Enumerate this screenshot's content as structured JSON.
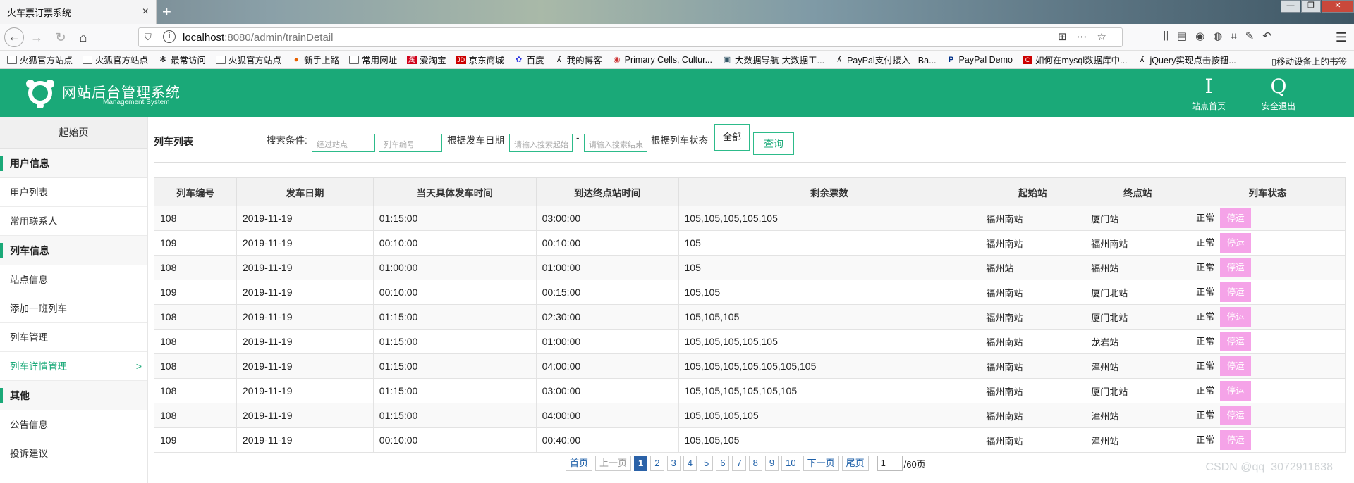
{
  "browser": {
    "tab_title": "火车票订票系统",
    "tab_close": "×",
    "new_tab": "+",
    "url_host": "localhost",
    "url_rest": ":8080/admin/trainDetail",
    "nav_back": "←",
    "nav_forward": "→",
    "nav_reload": "↻",
    "nav_home": "⌂",
    "window_controls": [
      "—",
      "❐",
      "✕"
    ]
  },
  "bookmarks": [
    {
      "label": "火狐官方站点",
      "icon": "folder-icon"
    },
    {
      "label": "火狐官方站点",
      "icon": "folder-icon"
    },
    {
      "label": "最常访问",
      "icon": "gear-icon"
    },
    {
      "label": "火狐官方站点",
      "icon": "folder-icon"
    },
    {
      "label": "新手上路",
      "icon": "firefox-icon"
    },
    {
      "label": "常用网址",
      "icon": "folder-icon"
    },
    {
      "label": "爱淘宝",
      "icon": "taobao-icon"
    },
    {
      "label": "京东商城",
      "icon": "jd-icon"
    },
    {
      "label": "百度",
      "icon": "baidu-icon"
    },
    {
      "label": "我的博客",
      "icon": "blog-icon"
    },
    {
      "label": "Primary Cells, Cultur...",
      "icon": "cell-icon"
    },
    {
      "label": "大数据导航-大数据工...",
      "icon": "bigdata-icon"
    },
    {
      "label": "PayPal支付接入 - Ba...",
      "icon": "blog-icon"
    },
    {
      "label": "PayPal Demo",
      "icon": "paypal-icon"
    },
    {
      "label": "如何在mysql数据库中...",
      "icon": "csdn-icon"
    },
    {
      "label": "jQuery实现点击按钮...",
      "icon": "blog-icon"
    }
  ],
  "bookmarks_mobile": "移动设备上的书签",
  "header": {
    "title": "网站后台管理系统",
    "subtitle": "Management System",
    "home_glyph": "I",
    "home_label": "站点首页",
    "logout_glyph": "Q",
    "logout_label": "安全退出"
  },
  "sidebar": {
    "start": "起始页",
    "groups": [
      {
        "title": "用户信息",
        "items": [
          "用户列表",
          "常用联系人"
        ]
      },
      {
        "title": "列车信息",
        "items": [
          "站点信息",
          "添加一班列车",
          "列车管理",
          "列车详情管理"
        ]
      },
      {
        "title": "其他",
        "items": [
          "公告信息",
          "投诉建议"
        ]
      }
    ],
    "active_arrow": ">"
  },
  "filters": {
    "list_title": "列车列表",
    "search_label": "搜索条件:",
    "station_placeholder": "经过站点",
    "train_placeholder": "列车编号",
    "date_label": "根据发车日期",
    "date_start_placeholder": "请输入搜索起始",
    "date_dash": "-",
    "date_end_placeholder": "请输入搜索结束",
    "status_label": "根据列车状态",
    "status_value": "全部",
    "query_button": "查询"
  },
  "table": {
    "headers": [
      "列车编号",
      "发车日期",
      "当天具体发车时间",
      "到达终点站时间",
      "剩余票数",
      "起始站",
      "终点站",
      "列车状态"
    ],
    "rows": [
      [
        "108",
        "2019-11-19",
        "01:15:00",
        "03:00:00",
        "105,105,105,105,105",
        "福州南站",
        "厦门站",
        "正常",
        "停运"
      ],
      [
        "109",
        "2019-11-19",
        "00:10:00",
        "00:10:00",
        "105",
        "福州南站",
        "福州南站",
        "正常",
        "停运"
      ],
      [
        "108",
        "2019-11-19",
        "01:00:00",
        "01:00:00",
        "105",
        "福州站",
        "福州站",
        "正常",
        "停运"
      ],
      [
        "109",
        "2019-11-19",
        "00:10:00",
        "00:15:00",
        "105,105",
        "福州南站",
        "厦门北站",
        "正常",
        "停运"
      ],
      [
        "108",
        "2019-11-19",
        "01:15:00",
        "02:30:00",
        "105,105,105",
        "福州南站",
        "厦门北站",
        "正常",
        "停运"
      ],
      [
        "108",
        "2019-11-19",
        "01:15:00",
        "01:00:00",
        "105,105,105,105,105",
        "福州南站",
        "龙岩站",
        "正常",
        "停运"
      ],
      [
        "108",
        "2019-11-19",
        "01:15:00",
        "04:00:00",
        "105,105,105,105,105,105,105",
        "福州南站",
        "漳州站",
        "正常",
        "停运"
      ],
      [
        "108",
        "2019-11-19",
        "01:15:00",
        "03:00:00",
        "105,105,105,105,105,105",
        "福州南站",
        "厦门北站",
        "正常",
        "停运"
      ],
      [
        "108",
        "2019-11-19",
        "01:15:00",
        "04:00:00",
        "105,105,105,105",
        "福州南站",
        "漳州站",
        "正常",
        "停运"
      ],
      [
        "109",
        "2019-11-19",
        "00:10:00",
        "00:40:00",
        "105,105,105",
        "福州南站",
        "漳州站",
        "正常",
        "停运"
      ]
    ]
  },
  "pager": {
    "first": "首页",
    "prev": "上一页",
    "pages": [
      "1",
      "2",
      "3",
      "4",
      "5",
      "6",
      "7",
      "8",
      "9",
      "10"
    ],
    "current": "1",
    "next": "下一页",
    "last": "尾页",
    "input_value": "1",
    "total": "/60页"
  },
  "watermark": "CSDN @qq_3072911638",
  "colors": {
    "brand": "#1aa978",
    "stop_button": "#f5a3e8",
    "pager_current": "#2b62a8"
  }
}
